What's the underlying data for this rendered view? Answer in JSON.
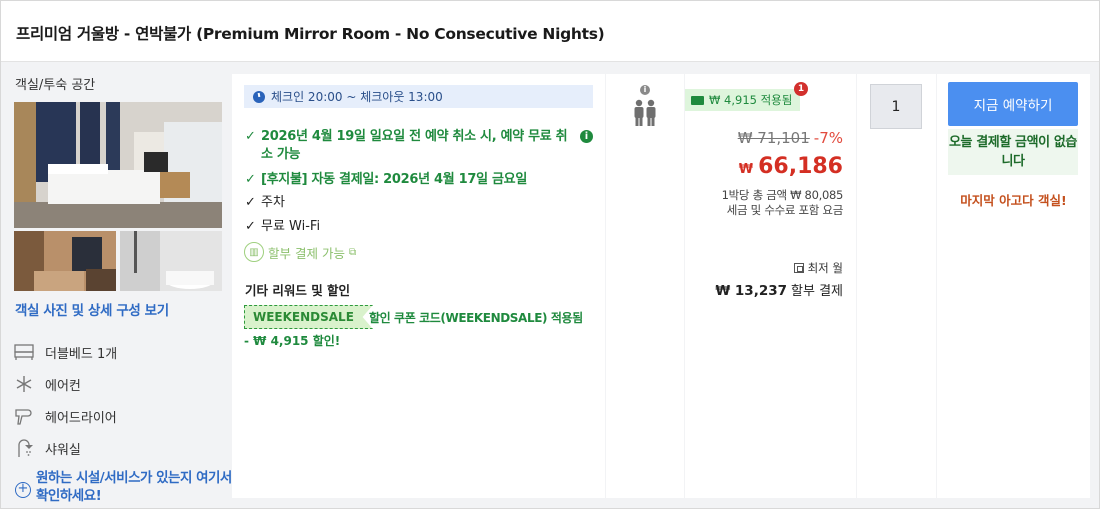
{
  "room": {
    "title": "프리미엄 거울방 - 연박불가 (Premium Mirror Room - No Consecutive Nights)"
  },
  "left": {
    "section_label": "객실/투숙 공간",
    "photos_link": "객실 사진 및 상세 구성 보기",
    "amenities": [
      {
        "icon": "bed-icon",
        "label": "더블베드 1개"
      },
      {
        "icon": "snowflake-icon",
        "label": "에어컨"
      },
      {
        "icon": "hairdryer-icon",
        "label": "헤어드라이어"
      },
      {
        "icon": "shower-icon",
        "label": "샤워실"
      }
    ],
    "inquiry_text": "원하는 시설/서비스가 있는지 여기서 확인하세요!"
  },
  "info": {
    "checkin": "체크인 20:00 ~ 체크아웃 13:00",
    "cancel_policy": "2026년 4월 19일 일요일 전 예약 취소 시, 예약 무료 취소 가능",
    "postpay": "[후지불] 자동 결제일: 2026년 4월 17일 금요일",
    "parking": "주차",
    "wifi": "무료 Wi-Fi",
    "installment": "할부 결제 가능",
    "rewards_title": "기타 리워드 및 할인",
    "coupon_code": "WEEKENDSALE",
    "coupon_desc": "할인 쿠폰 코드(WEEKENDSALE) 적용됨",
    "coupon_saving": "- ₩ 4,915 할인!"
  },
  "price": {
    "coupon_badge": "₩ 4,915 적용됨",
    "notification_count": "1",
    "original": "₩ 71,101",
    "discount": "-7%",
    "currency": "₩",
    "final": "66,186",
    "total_line": "1박당 총 금액 ₩ 80,085",
    "tax_line": "세금 및 수수료 포함 요금",
    "monthly_label": "최저 월",
    "installment_amount": "₩ 13,237",
    "installment_suffix": "할부 결제"
  },
  "quantity": {
    "value": "1"
  },
  "booking": {
    "button": "지금 예약하기",
    "pay_today": "오늘 결제할 금액이 없습니다",
    "last_room": "마지막 아고다 객실!"
  },
  "colors": {
    "accent_blue": "#4b8ff0",
    "link_blue": "#2f6bc4",
    "green": "#1f8a3e",
    "price_red": "#d42f23",
    "orange": "#c4501d"
  }
}
